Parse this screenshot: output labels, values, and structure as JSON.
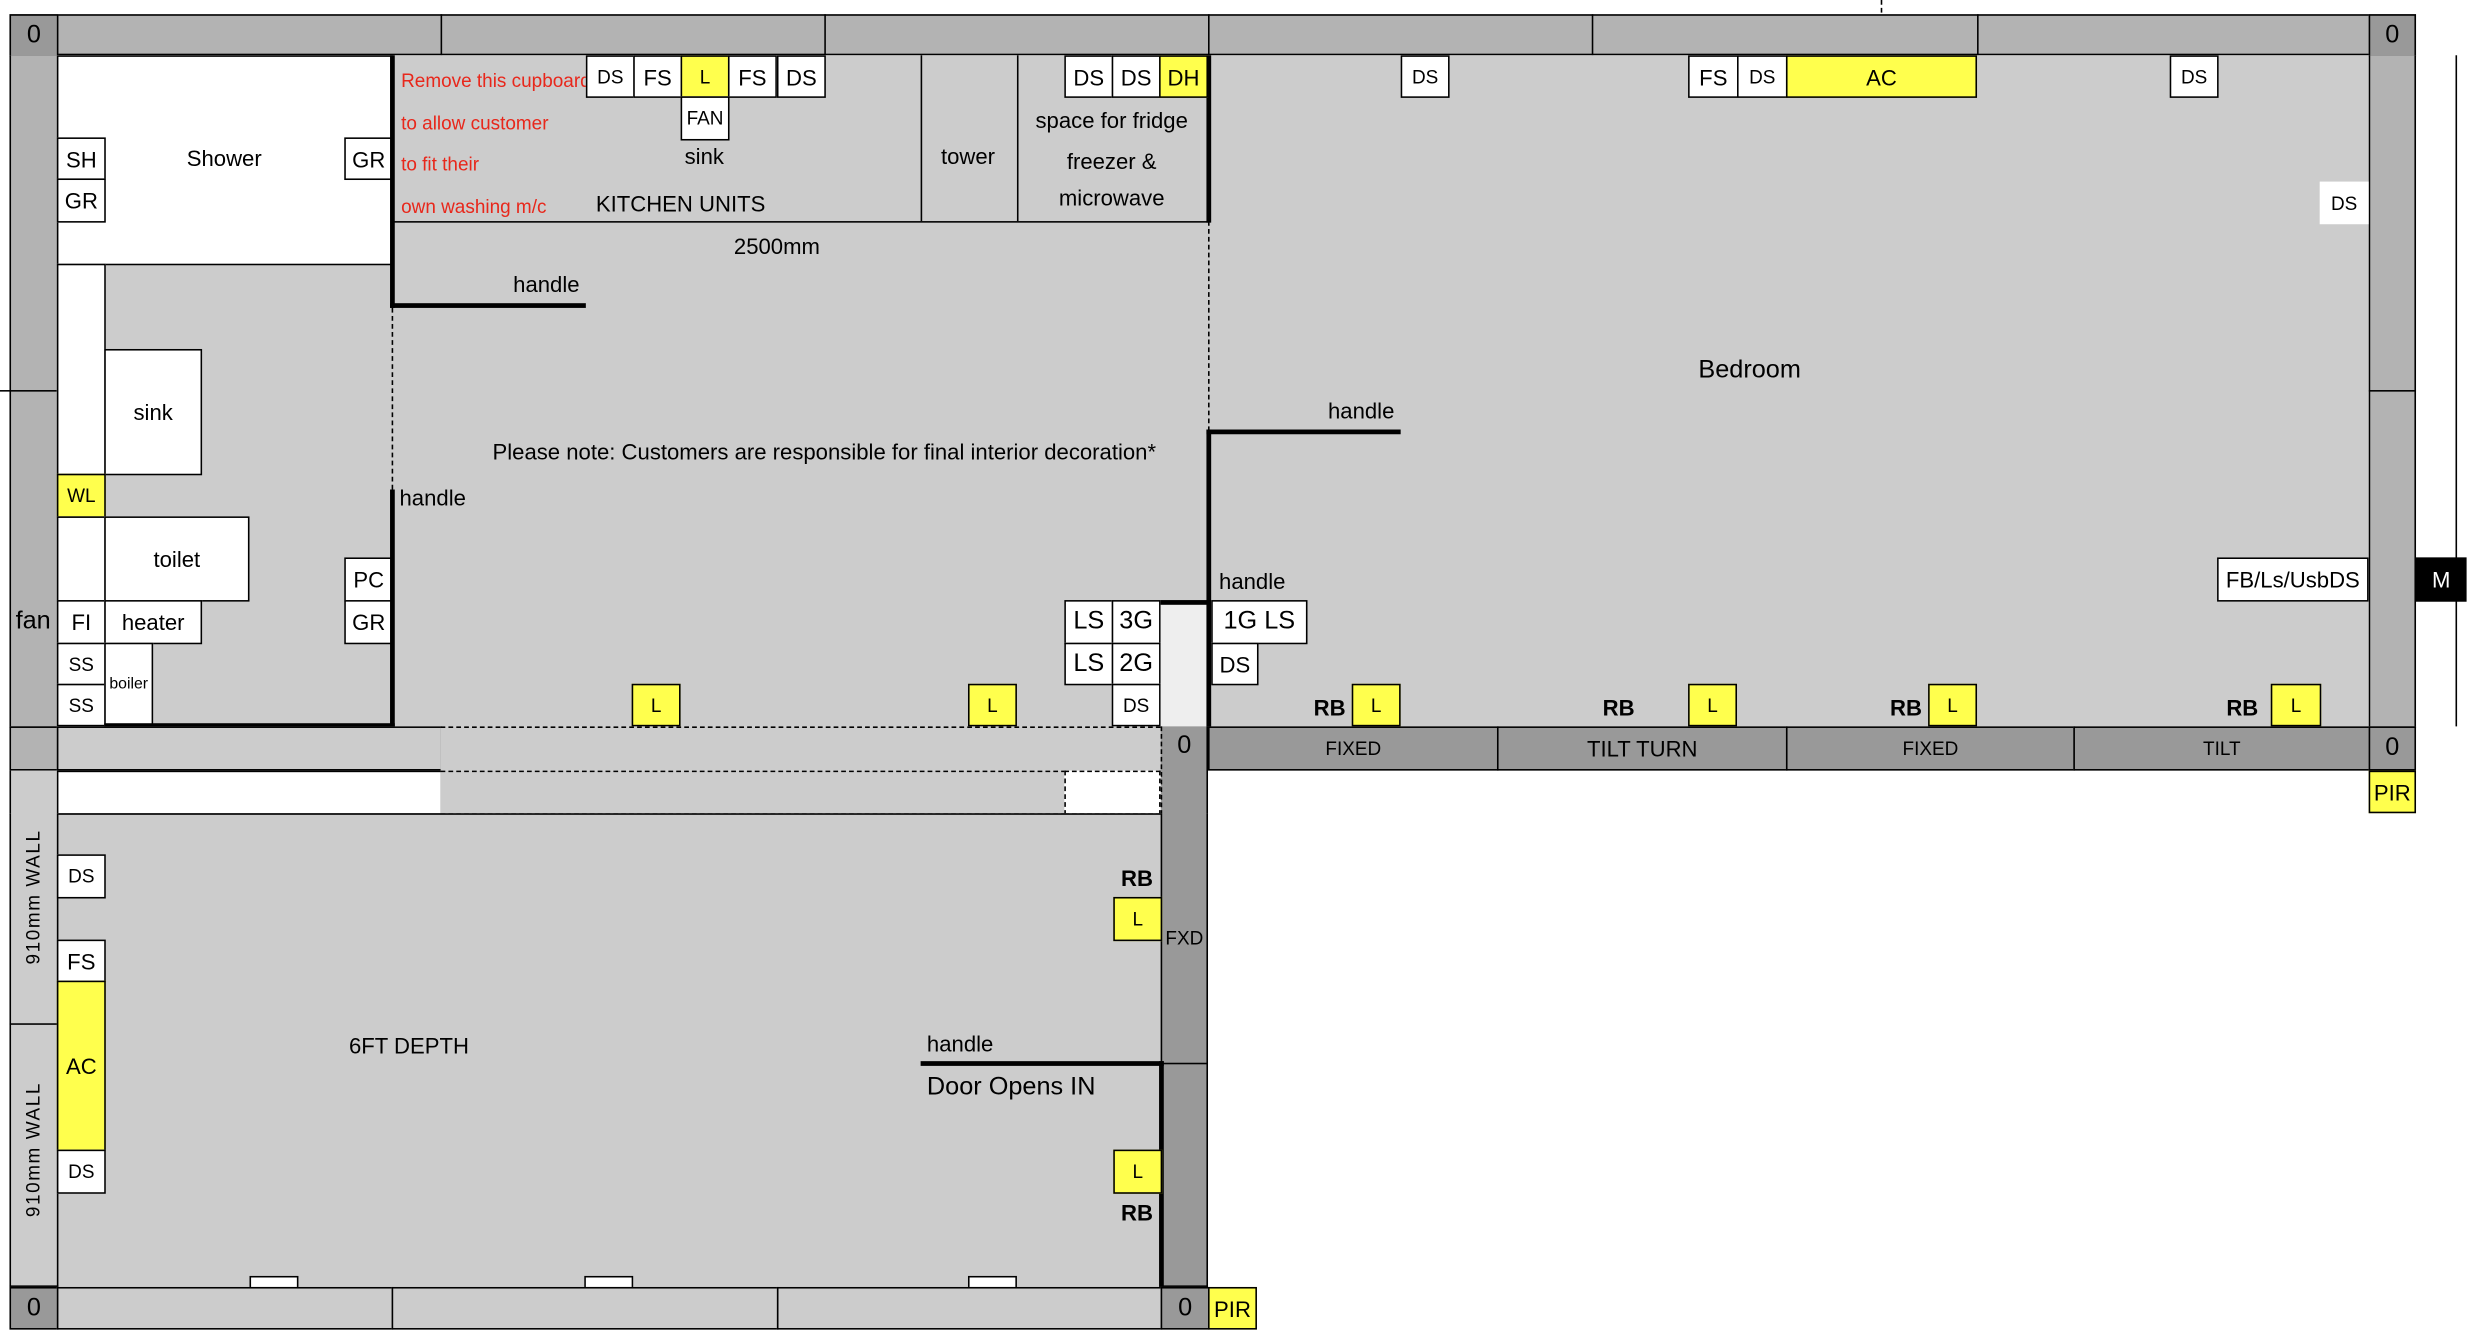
{
  "corners": {
    "zero": "0"
  },
  "colors": {
    "wall": "#b3b3b3",
    "floor": "#cccccc",
    "frame": "#999999",
    "highlight": "#ffff4d",
    "note_red": "#e8271b"
  },
  "bathroom": {
    "shower": "Shower",
    "sh": "SH",
    "gr1": "GR",
    "gr2": "GR",
    "sink": "sink",
    "wl": "WL",
    "toilet": "toilet",
    "fi": "FI",
    "heater": "heater",
    "ss1": "SS",
    "ss2": "SS",
    "boiler": "boiler",
    "pc": "PC",
    "gr3": "GR",
    "fan": "fan"
  },
  "kitchen": {
    "note_lines": [
      "Remove this cupboard",
      "to allow customer",
      "to fit their",
      "own washing m/c"
    ],
    "top_sockets": [
      "DS",
      "FS",
      "L",
      "FS",
      "DS"
    ],
    "fan": "FAN",
    "sink": "sink",
    "units": "KITCHEN UNITS",
    "tower": "tower",
    "fridge_sockets": [
      "DS",
      "DS",
      "DH"
    ],
    "fridge_lines": [
      "space for fridge",
      "freezer &",
      "microwave"
    ],
    "dimension": "2500mm",
    "handle1": "handle",
    "handle2": "handle",
    "notice": "Please note: Customers are responsible for final interior decoration*",
    "switches": [
      "LS",
      "3G",
      "LS",
      "2G",
      "DS"
    ],
    "lights": [
      "L",
      "L"
    ]
  },
  "bedroom": {
    "title": "Bedroom",
    "top_sockets": [
      "DS",
      "FS",
      "DS",
      "AC",
      "DS"
    ],
    "ds_right": "DS",
    "fb": "FB/Ls/UsbDS",
    "m": "M",
    "handle1": "handle",
    "handle2": "handle",
    "switch": "1G LS",
    "ds": "DS",
    "rb": [
      "RB",
      "RB",
      "RB",
      "RB"
    ],
    "lights": [
      "L",
      "L",
      "L",
      "L"
    ],
    "windows": [
      "FIXED",
      "TILT TURN",
      "FIXED",
      "TILT"
    ],
    "pir": "PIR"
  },
  "lower": {
    "wall1": "910mm WALL",
    "wall2": "910mm WALL",
    "ds1": "DS",
    "fs": "FS",
    "ac": "AC",
    "ds2": "DS",
    "depth": "6FT DEPTH",
    "rb1": "RB",
    "l1": "L",
    "fxd": "FXD",
    "handle": "handle",
    "door": "Door Opens IN",
    "l2": "L",
    "rb2": "RB",
    "pir": "PIR"
  }
}
